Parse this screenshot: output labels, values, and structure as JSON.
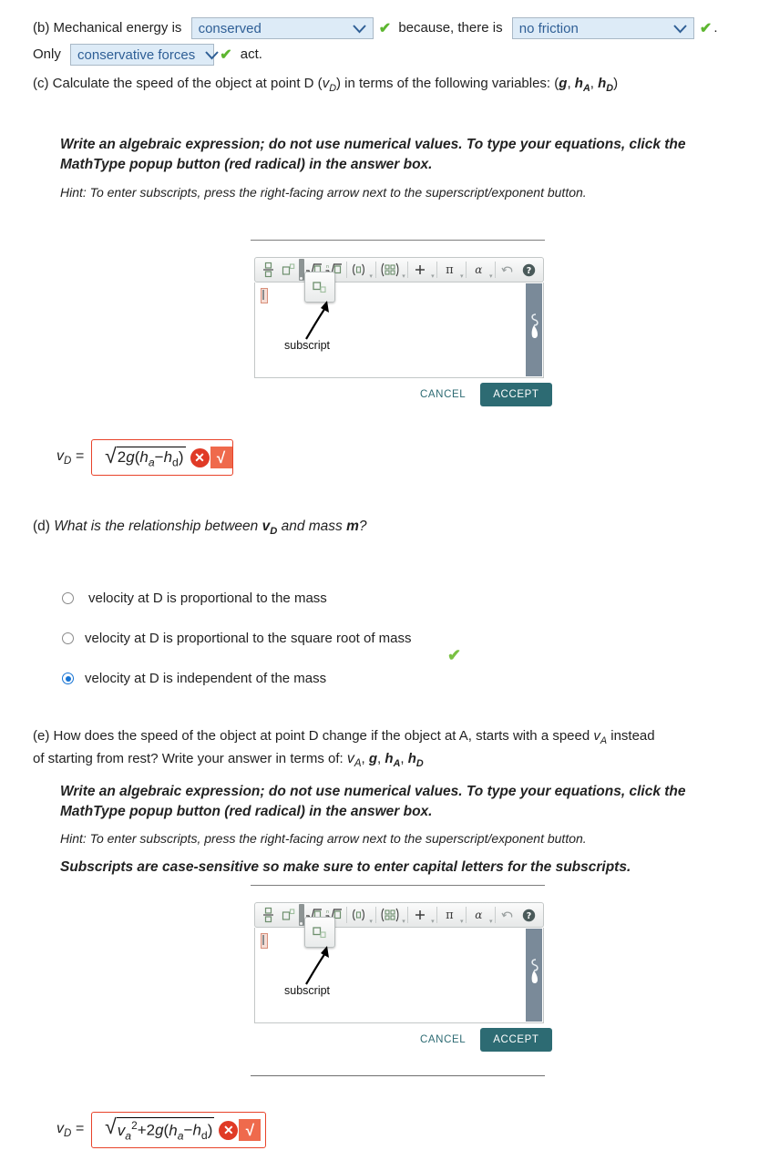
{
  "part_b": {
    "prefix": "(b) Mechanical energy is",
    "dropdown1_value": "conserved",
    "mid_text": "because, there is",
    "dropdown2_value": "no friction",
    "period": ".",
    "only_text": "Only",
    "dropdown3_value": "conservative forces",
    "act_text": "act.",
    "check": "✔"
  },
  "part_c": {
    "question": "(c) Calculate the speed of the object at point D (vD) in terms of the following variables: (g, hA, hD)",
    "question_pre": "(c) Calculate the speed of the object at point D (",
    "question_mid": ") in terms of the following variables: (",
    "question_end": ")",
    "instruction": "Write an algebraic expression; do not use numerical values. To type your equations, click the MathType popup button (red radical) in the answer box.",
    "hint": "Hint: To enter subscripts, press the right-facing arrow next to the superscript/exponent button.",
    "answer_label": "vD =",
    "answer_expression": "√2g(ha − hd)"
  },
  "part_d": {
    "question_pre": "(d) ",
    "question": "What is the relationship between vD and mass m?",
    "options": [
      {
        "label": "velocity at D is proportional to the mass",
        "selected": false
      },
      {
        "label": "velocity at D is proportional to the square root of mass",
        "selected": false
      },
      {
        "label": "velocity at D is independent of the mass",
        "selected": true
      }
    ],
    "correct_check": "✔"
  },
  "part_e": {
    "question_line1": "(e) How does the speed of the object at point D change if the object at A, starts with a speed vA instead",
    "question_line2": "of starting from rest? Write your answer in terms of: vA, g, hA, hD",
    "instruction": "Write an algebraic expression; do not use numerical values. To type your equations, click the MathType popup button (red radical) in the answer box.",
    "hint": "Hint: To enter subscripts, press the right-facing arrow next to the superscript/exponent button.",
    "note": "Subscripts are case-sensitive so make sure to enter capital letters for the subscripts.",
    "answer_label": "vD =",
    "answer_expression": "√(va² + 2g(ha − hd))"
  },
  "mathtype": {
    "toolbar_buttons": [
      "fraction-icon",
      "superscript-icon",
      "sqrt-icon",
      "nth-root-icon",
      "parenthesis-icon",
      "matrix-icon",
      "plus-minus-icon",
      "pi-icon",
      "alpha-icon",
      "undo-icon",
      "help-icon"
    ],
    "popup_tooltip_label": "subscript",
    "popup_button_name": "subscript-icon",
    "cancel_label": "CANCEL",
    "accept_label": "ACCEPT",
    "handwriting_icon": "handwriting-icon"
  },
  "colors": {
    "dropdown_bg": "#ddebf7",
    "dropdown_text": "#2f5f96",
    "check_green": "#5db630",
    "answer_border_red": "#e8432a",
    "accept_teal": "#2d6b73",
    "radio_blue": "#1673d4"
  }
}
